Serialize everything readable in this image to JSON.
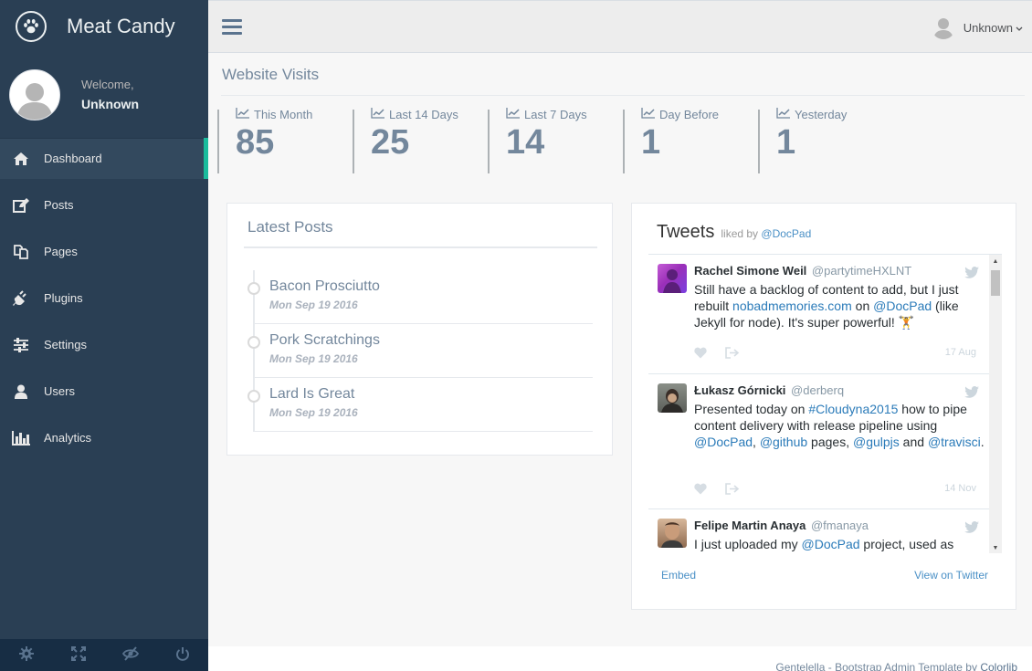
{
  "brand": {
    "name": "Meat Candy"
  },
  "profile": {
    "welcome": "Welcome,",
    "name": "Unknown"
  },
  "menu": [
    {
      "label": "Dashboard",
      "icon": "home-icon",
      "active": true
    },
    {
      "label": "Posts",
      "icon": "edit-icon"
    },
    {
      "label": "Pages",
      "icon": "pages-icon"
    },
    {
      "label": "Plugins",
      "icon": "plug-icon"
    },
    {
      "label": "Settings",
      "icon": "sliders-icon"
    },
    {
      "label": "Users",
      "icon": "user-icon"
    },
    {
      "label": "Analytics",
      "icon": "bar-chart-icon"
    }
  ],
  "sidebar_footer": [
    "gear-icon",
    "fullscreen-icon",
    "eye-slash-icon",
    "power-icon"
  ],
  "topnav": {
    "user_name": "Unknown"
  },
  "visits": {
    "title": "Website Visits",
    "tiles": [
      {
        "label": "This Month",
        "count": "85"
      },
      {
        "label": "Last 14 Days",
        "count": "25"
      },
      {
        "label": "Last 7 Days",
        "count": "14"
      },
      {
        "label": "Day Before",
        "count": "1"
      },
      {
        "label": "Yesterday",
        "count": "1"
      }
    ]
  },
  "latest_posts": {
    "title": "Latest Posts",
    "items": [
      {
        "title": "Bacon Prosciutto",
        "date": "Mon Sep 19 2016"
      },
      {
        "title": "Pork Scratchings",
        "date": "Mon Sep 19 2016"
      },
      {
        "title": "Lard Is Great",
        "date": "Mon Sep 19 2016"
      }
    ]
  },
  "tweets": {
    "title": "Tweets",
    "liked_by": "liked by",
    "liked_handle": "@DocPad",
    "items": [
      {
        "name": "Rachel Simone Weil",
        "handle": "@partytimeHXLNT",
        "date": "17 Aug",
        "text_parts": [
          {
            "t": "Still have a backlog of content to add, but I just rebuilt "
          },
          {
            "t": "nobadmemories.com",
            "link": true
          },
          {
            "t": " on "
          },
          {
            "t": "@DocPad",
            "link": true
          },
          {
            "t": " (like Jekyll for node). It's super powerful! 🏋"
          }
        ]
      },
      {
        "name": "Łukasz Górnicki",
        "handle": "@derberq",
        "date": "14 Nov",
        "text_parts": [
          {
            "t": "Presented today on "
          },
          {
            "t": "#Cloudyna2015",
            "link": true
          },
          {
            "t": " how to pipe content delivery with release pipeline using "
          },
          {
            "t": "@DocPad",
            "link": true
          },
          {
            "t": ", "
          },
          {
            "t": "@github",
            "link": true
          },
          {
            "t": " pages, "
          },
          {
            "t": "@gulpjs",
            "link": true
          },
          {
            "t": " and "
          },
          {
            "t": "@travisci",
            "link": true
          },
          {
            "t": "."
          }
        ]
      },
      {
        "name": "Felipe Martin Anaya",
        "handle": "@fmanaya",
        "date": "",
        "text_parts": [
          {
            "t": "I just uploaded my "
          },
          {
            "t": "@DocPad",
            "link": true
          },
          {
            "t": " project, used as"
          }
        ]
      }
    ],
    "embed": "Embed",
    "view_on_twitter": "View on Twitter"
  },
  "footer": {
    "text": "Gentelella - Bootstrap Admin Template by ",
    "link": "Colorlib"
  },
  "colors": {
    "sidebar": "#2A3F54",
    "accent": "#1ABB9C",
    "text": "#73879C",
    "link": "#2B7BB9"
  }
}
